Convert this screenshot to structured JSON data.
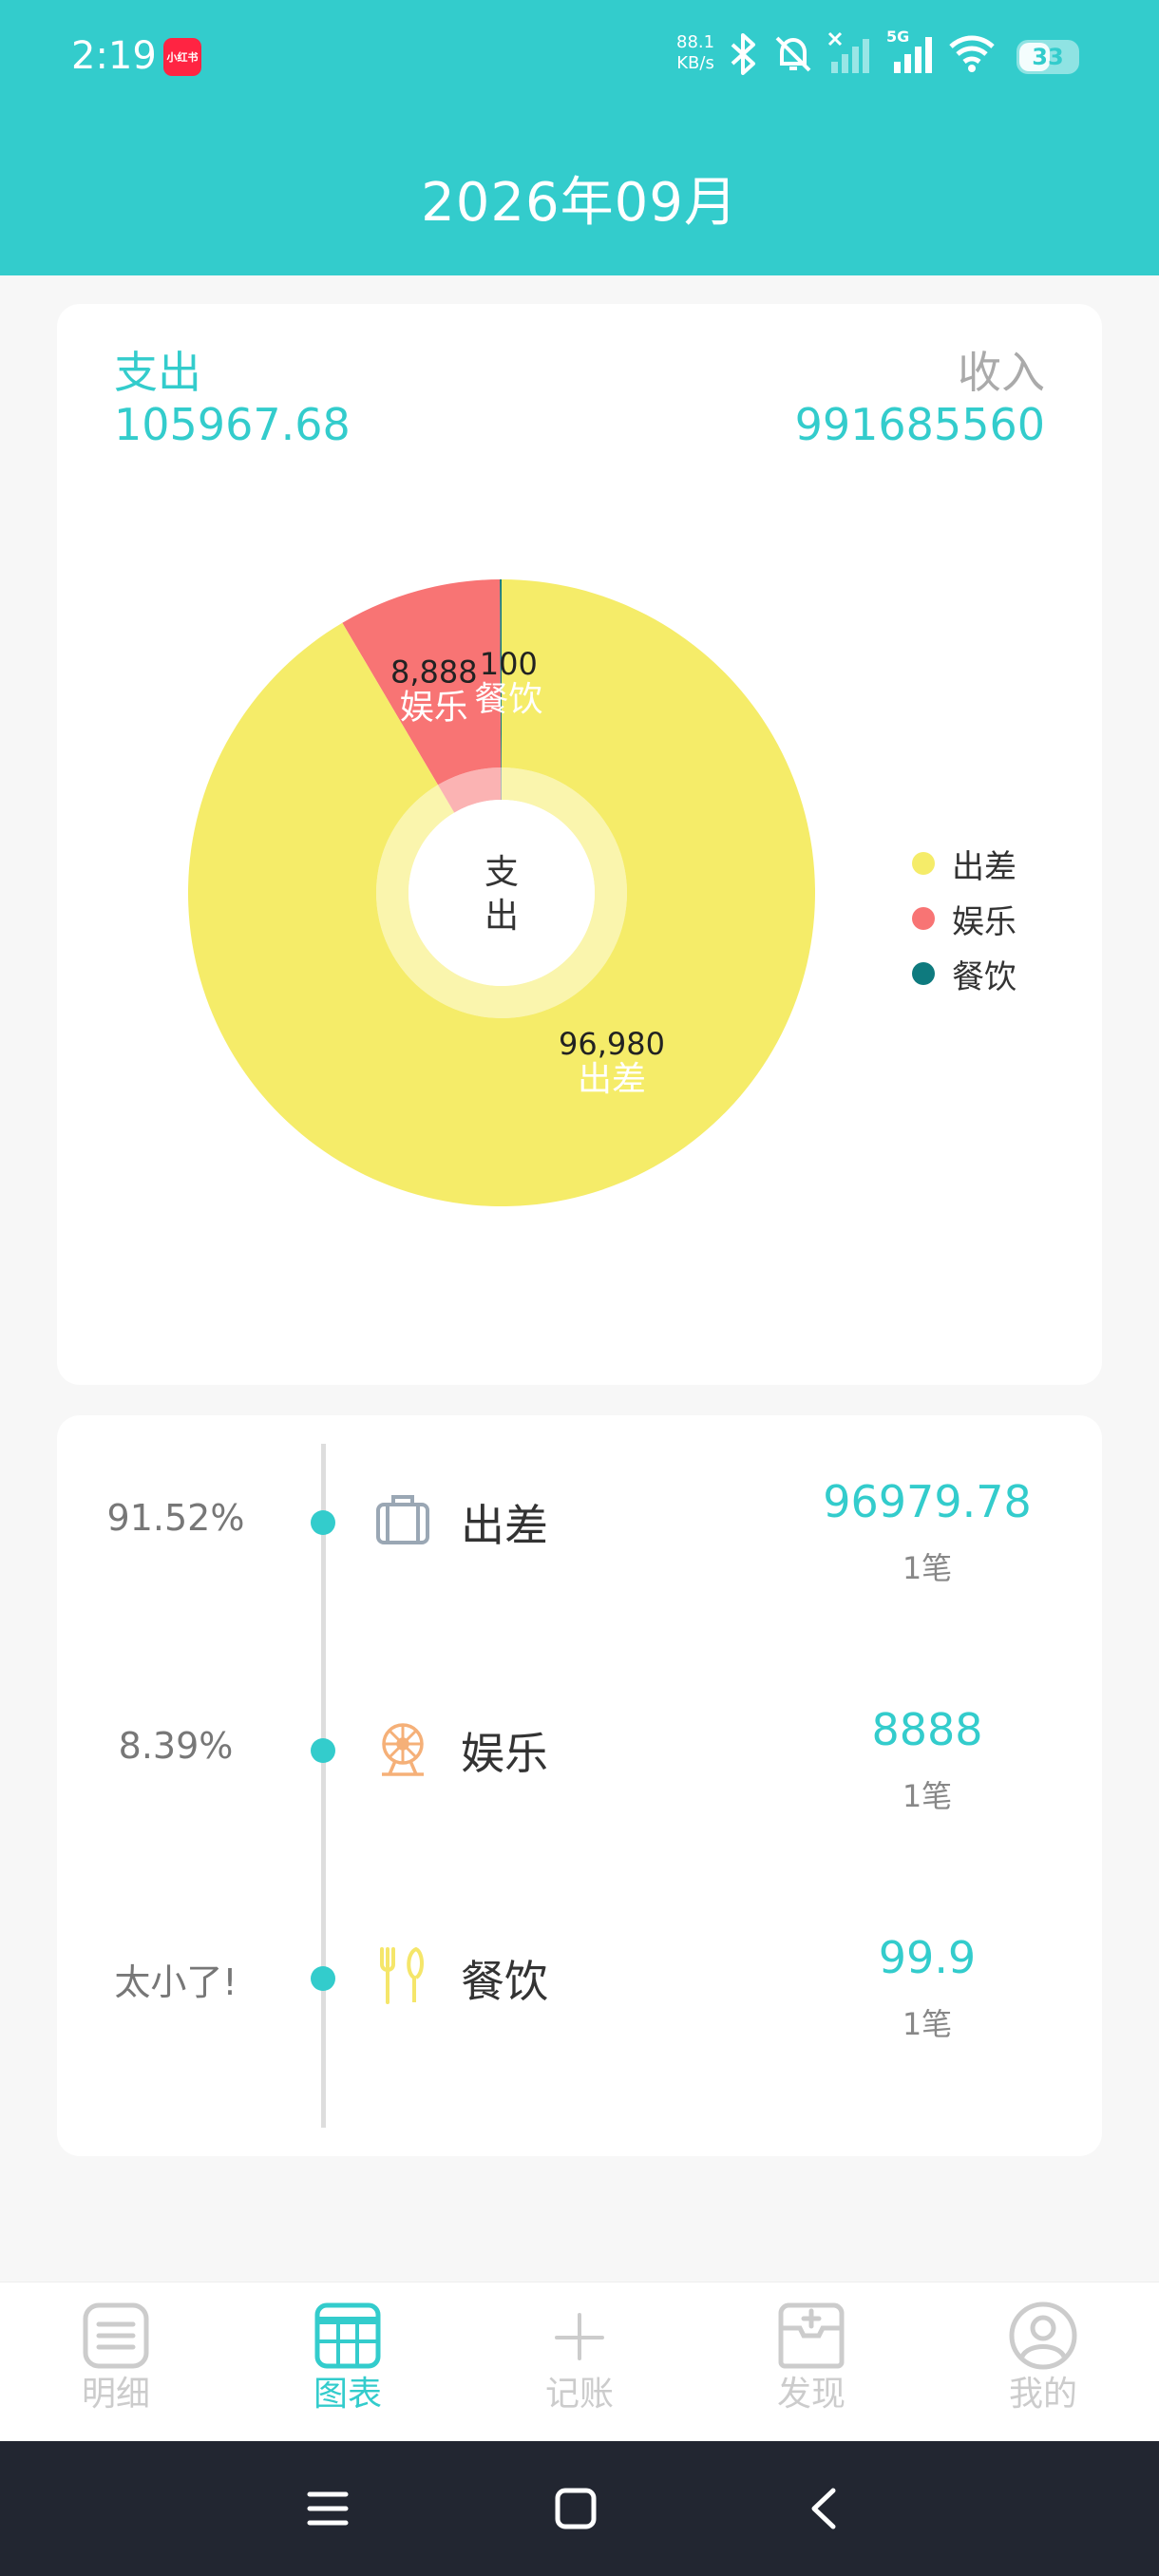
{
  "status_bar": {
    "time": "2:19",
    "app_badge": "小红书",
    "net_speed_value": "88.1",
    "net_speed_unit": "KB/s",
    "network_type": "5G",
    "battery": "33"
  },
  "header": {
    "title": "2026年09月"
  },
  "summary": {
    "expense_label": "支出",
    "expense_value": "105967.68",
    "income_label": "收入",
    "income_value": "991685560"
  },
  "chart_data": {
    "type": "pie",
    "center_label": "支\n出",
    "slices": [
      {
        "name": "出差",
        "value": 96980,
        "value_label": "96,980",
        "color": "#f5ec69"
      },
      {
        "name": "娱乐",
        "value": 8888,
        "value_label": "8,888",
        "color": "#f87474"
      },
      {
        "name": "餐饮",
        "value": 100,
        "value_label": "100",
        "color": "#0e7a7e"
      }
    ],
    "legend_position": "right"
  },
  "legend": [
    {
      "label": "出差",
      "color": "#f5ec69"
    },
    {
      "label": "娱乐",
      "color": "#f87474"
    },
    {
      "label": "餐饮",
      "color": "#0e7a7e"
    }
  ],
  "breakdown": [
    {
      "percent": "91.52%",
      "icon": "suitcase-icon",
      "name": "出差",
      "amount": "96979.78",
      "count": "1笔"
    },
    {
      "percent": "8.39%",
      "icon": "ferris-wheel-icon",
      "name": "娱乐",
      "amount": "8888",
      "count": "1笔"
    },
    {
      "percent": "太小了!",
      "icon": "fork-knife-icon",
      "name": "餐饮",
      "amount": "99.9",
      "count": "1笔"
    }
  ],
  "tabs": [
    {
      "label": "明细",
      "icon": "list-icon"
    },
    {
      "label": "图表",
      "icon": "table-chart-icon"
    },
    {
      "label": "记账",
      "icon": "plus-icon"
    },
    {
      "label": "发现",
      "icon": "discover-icon"
    },
    {
      "label": "我的",
      "icon": "profile-icon"
    }
  ],
  "colors": {
    "brand": "#33cccc",
    "nav_bar": "#222631"
  }
}
